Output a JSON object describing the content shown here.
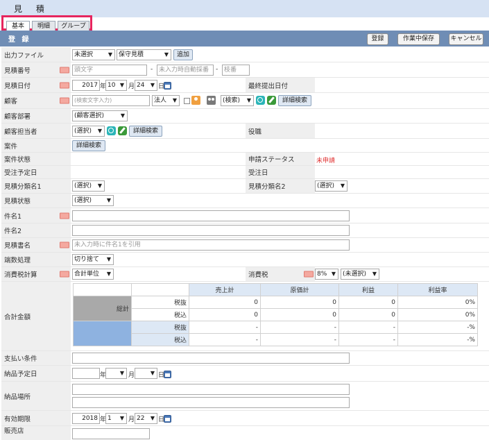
{
  "window": {
    "title": "見 積"
  },
  "tabs": [
    {
      "label": "基本"
    },
    {
      "label": "明細"
    },
    {
      "label": "グループ"
    }
  ],
  "section": {
    "label": "登 録"
  },
  "actions": {
    "register": "登録",
    "save_draft": "作業中保存",
    "cancel": "キャンセル"
  },
  "fields": {
    "output_file": {
      "label": "出力ファイル",
      "select1": "未選択",
      "select2": "保守見積",
      "add": "追加"
    },
    "quote_no": {
      "label": "見積番号",
      "ph1": "頭文字",
      "dash": "-",
      "ph2": "未入力時自動採番",
      "ph3": "枝番"
    },
    "quote_date": {
      "label": "見積日付",
      "year": "2017",
      "year_unit": "年",
      "month": "10",
      "month_unit": "月",
      "day": "24",
      "day_unit": "日",
      "right_label": "最終提出日付"
    },
    "customer": {
      "label": "顧客",
      "ph": "(検索文字入力)",
      "type": "法人",
      "search": "(検索)",
      "detail": "詳細検索"
    },
    "customer_dept": {
      "label": "顧客部署",
      "select": "(顧客選択)"
    },
    "customer_rep": {
      "label": "顧客担当者",
      "select": "(選択)",
      "detail": "詳細検索",
      "right_label": "役職"
    },
    "case": {
      "label": "案件",
      "detail": "詳細検索"
    },
    "case_status": {
      "label": "案件状態",
      "right_label": "申請ステータス",
      "right_value": "未申請"
    },
    "order_plan": {
      "label": "受注予定日",
      "right_label": "受注日"
    },
    "class1": {
      "label": "見積分類名1",
      "select": "(選択)",
      "right_label": "見積分類名2",
      "right_select": "(選択)"
    },
    "status": {
      "label": "見積状態",
      "select": "(選択)"
    },
    "subject1": {
      "label": "件名1"
    },
    "subject2": {
      "label": "件名2"
    },
    "doc_name": {
      "label": "見積書名",
      "ph": "未入力時に件名1を引用"
    },
    "rounding": {
      "label": "端数処理",
      "select": "切り捨て"
    },
    "tax_calc": {
      "label": "消費税計算",
      "select": "合計単位",
      "right_label": "消費税",
      "rate": "8%",
      "right_select": "(未選択)"
    },
    "total": {
      "label": "合計金額"
    },
    "payment": {
      "label": "支払い条件"
    },
    "delivery_date": {
      "label": "納品予定日",
      "year_unit": "年",
      "month_unit": "月",
      "day_unit": "日"
    },
    "delivery_place": {
      "label": "納品場所"
    },
    "valid_until": {
      "label": "有効期限",
      "year": "2018",
      "year_unit": "年",
      "month": "1",
      "month_unit": "月",
      "day": "22",
      "day_unit": "日"
    },
    "sales_store": {
      "label": "販売店"
    }
  },
  "summary": {
    "headers": [
      "売上計",
      "原価計",
      "利益",
      "利益率"
    ],
    "group1": "総計",
    "rows": [
      {
        "type": "税抜",
        "values": [
          "0",
          "0",
          "0",
          "0%"
        ]
      },
      {
        "type": "税込",
        "values": [
          "0",
          "0",
          "0",
          "0%"
        ]
      },
      {
        "type": "税抜",
        "values": [
          "-",
          "-",
          "-",
          "-%"
        ]
      },
      {
        "type": "税込",
        "values": [
          "-",
          "-",
          "-",
          "-%"
        ]
      }
    ]
  },
  "colors": {
    "accent_bar": "#6f8db5",
    "title_bar": "#d6e2f3",
    "tab_highlight": "#e6255e"
  }
}
